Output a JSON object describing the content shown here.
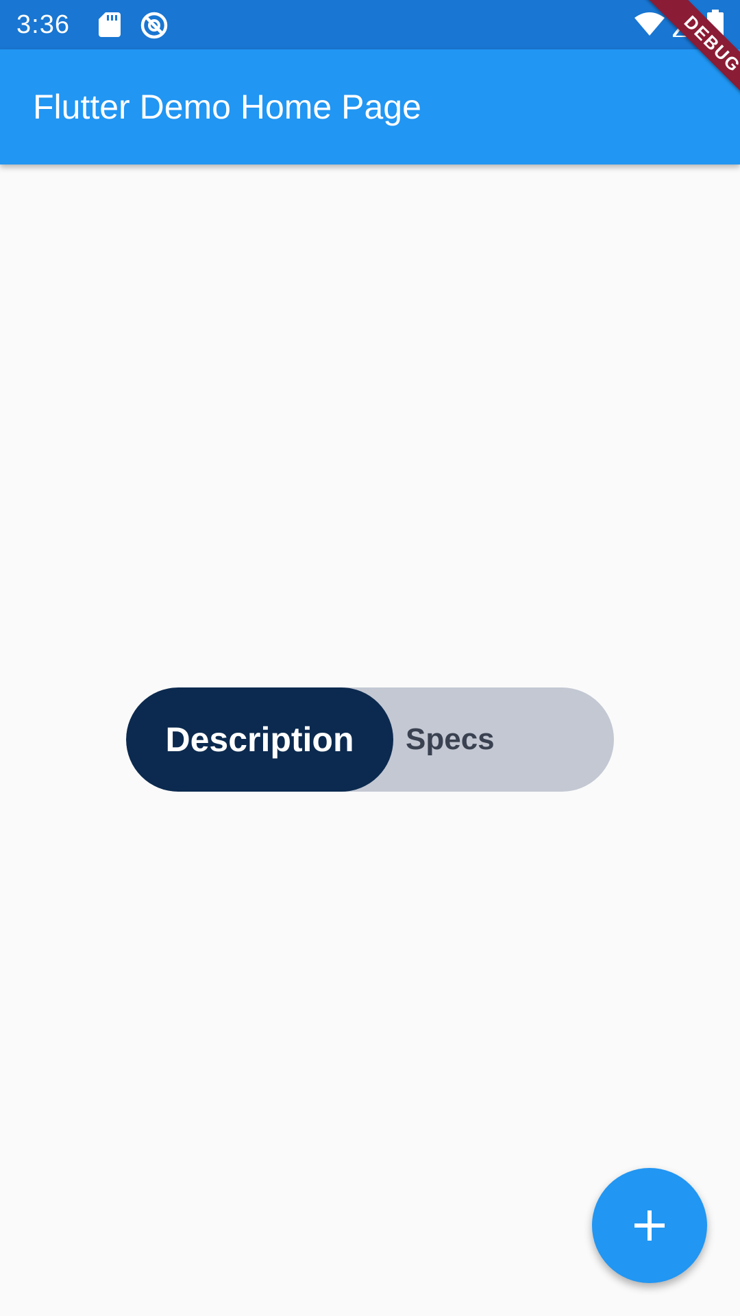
{
  "status_bar": {
    "time": "3:36",
    "icons": [
      "sd-card-icon",
      "sync-disabled-icon",
      "wifi-icon",
      "cell-signal-icon",
      "battery-icon"
    ],
    "background": "#1976d2"
  },
  "app_bar": {
    "title": "Flutter Demo Home Page",
    "background": "#2196f3"
  },
  "debug_banner": {
    "label": "DEBUG",
    "color": "#8b1c35"
  },
  "toggle": {
    "selected_label": "Description",
    "unselected_label": "Specs",
    "selected_background": "#0c2a4f",
    "track_background": "#c3c8d3"
  },
  "fab": {
    "icon": "add-icon",
    "background": "#2196f3"
  }
}
